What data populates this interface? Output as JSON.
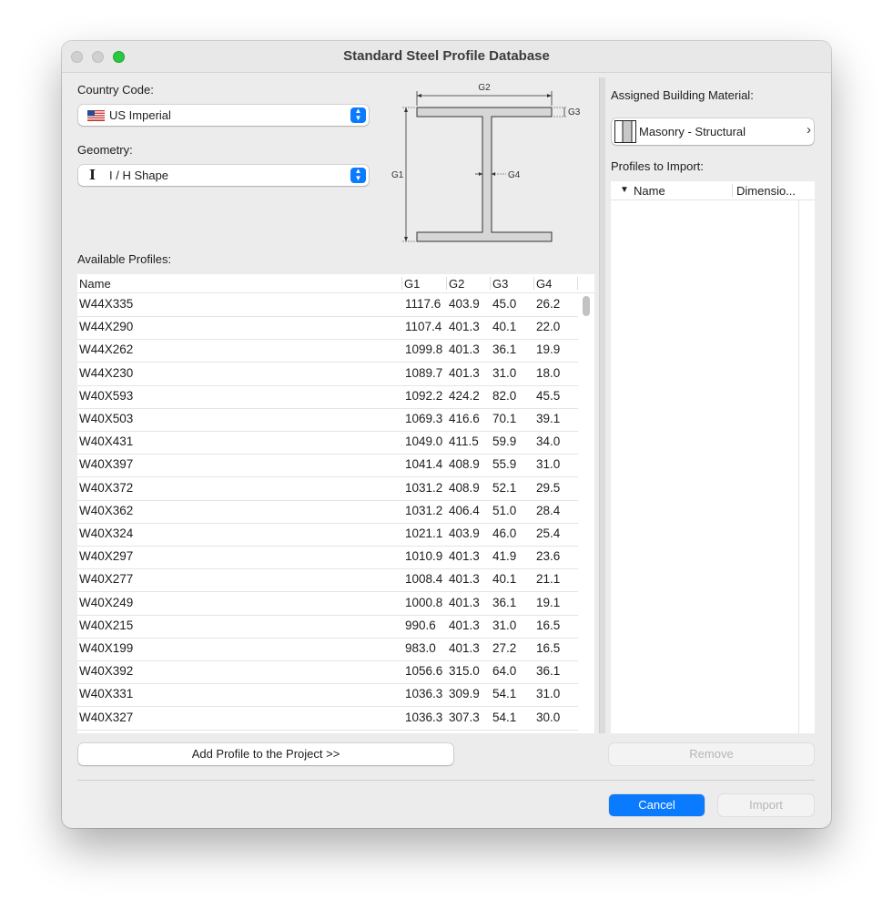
{
  "window": {
    "title": "Standard Steel Profile Database"
  },
  "country": {
    "label": "Country Code:",
    "value": "US Imperial"
  },
  "geometry": {
    "label": "Geometry:",
    "value": "I / H Shape",
    "icon_glyph": "I"
  },
  "diagram": {
    "g1": "G1",
    "g2": "G2",
    "g3": "G3",
    "g4": "G4"
  },
  "available": {
    "label": "Available Profiles:",
    "columns": [
      "Name",
      "G1",
      "G2",
      "G3",
      "G4"
    ],
    "rows": [
      [
        "W44X335",
        "1117.6",
        "403.9",
        "45.0",
        "26.2"
      ],
      [
        "W44X290",
        "1107.4",
        "401.3",
        "40.1",
        "22.0"
      ],
      [
        "W44X262",
        "1099.8",
        "401.3",
        "36.1",
        "19.9"
      ],
      [
        "W44X230",
        "1089.7",
        "401.3",
        "31.0",
        "18.0"
      ],
      [
        "W40X593",
        "1092.2",
        "424.2",
        "82.0",
        "45.5"
      ],
      [
        "W40X503",
        "1069.3",
        "416.6",
        "70.1",
        "39.1"
      ],
      [
        "W40X431",
        "1049.0",
        "411.5",
        "59.9",
        "34.0"
      ],
      [
        "W40X397",
        "1041.4",
        "408.9",
        "55.9",
        "31.0"
      ],
      [
        "W40X372",
        "1031.2",
        "408.9",
        "52.1",
        "29.5"
      ],
      [
        "W40X362",
        "1031.2",
        "406.4",
        "51.0",
        "28.4"
      ],
      [
        "W40X324",
        "1021.1",
        "403.9",
        "46.0",
        "25.4"
      ],
      [
        "W40X297",
        "1010.9",
        "401.3",
        "41.9",
        "23.6"
      ],
      [
        "W40X277",
        "1008.4",
        "401.3",
        "40.1",
        "21.1"
      ],
      [
        "W40X249",
        "1000.8",
        "401.3",
        "36.1",
        "19.1"
      ],
      [
        "W40X215",
        "990.6",
        "401.3",
        "31.0",
        "16.5"
      ],
      [
        "W40X199",
        "983.0",
        "401.3",
        "27.2",
        "16.5"
      ],
      [
        "W40X392",
        "1056.6",
        "315.0",
        "64.0",
        "36.1"
      ],
      [
        "W40X331",
        "1036.3",
        "309.9",
        "54.1",
        "31.0"
      ],
      [
        "W40X327",
        "1036.3",
        "307.3",
        "54.1",
        "30.0"
      ]
    ]
  },
  "add_button": "Add Profile to the Project >>",
  "material": {
    "label": "Assigned Building Material:",
    "value": "Masonry - Structural",
    "chevron": "›"
  },
  "import_list": {
    "label": "Profiles to Import:",
    "columns": [
      "Name",
      "Dimensio..."
    ],
    "sort_glyph": "▼"
  },
  "remove_button": "Remove",
  "cancel_button": "Cancel",
  "import_button": "Import"
}
